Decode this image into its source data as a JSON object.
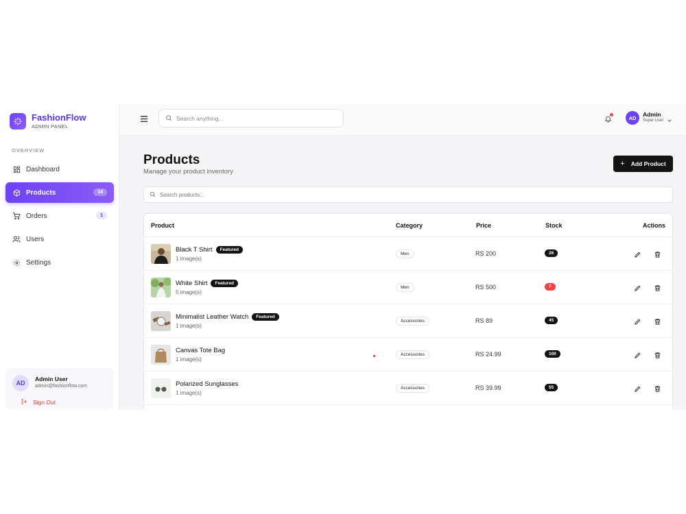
{
  "brand": {
    "name": "FashionFlow",
    "subtitle": "ADMIN PANEL"
  },
  "sidebar": {
    "section_label": "OVERVIEW",
    "items": [
      {
        "label": "Dashboard",
        "icon": "dashboard-icon",
        "badge": ""
      },
      {
        "label": "Products",
        "icon": "box-icon",
        "badge": "14",
        "active": true
      },
      {
        "label": "Orders",
        "icon": "cart-icon",
        "badge": "1"
      },
      {
        "label": "Users",
        "icon": "users-icon",
        "badge": ""
      },
      {
        "label": "Settings",
        "icon": "gear-icon",
        "badge": ""
      }
    ],
    "user": {
      "initials": "AD",
      "name": "Admin User",
      "email": "admin@fashionflow.com"
    },
    "signout_label": "Sign Out"
  },
  "header": {
    "search_placeholder": "Search anything...",
    "user": {
      "initials": "AD",
      "name": "Admin",
      "role": "Super User"
    }
  },
  "main": {
    "title": "Products",
    "subtitle": "Manage your product inventory",
    "add_button_label": "Add Product",
    "search_placeholder": "Search products...",
    "table": {
      "columns": {
        "product": "Product",
        "category": "Category",
        "price": "Price",
        "stock": "Stock",
        "actions": "Actions"
      },
      "rows": [
        {
          "name": "Black T Shirt",
          "featured": "Featured",
          "images": "1 image(s)",
          "category": "Men",
          "price": "RS 200",
          "stock": "26",
          "low": false
        },
        {
          "name": "White Shirt",
          "featured": "Featured",
          "images": "5 image(s)",
          "category": "Men",
          "price": "RS 500",
          "stock": "7",
          "low": true
        },
        {
          "name": "Minimalist Leather Watch",
          "featured": "Featured",
          "images": "1 image(s)",
          "category": "Accessories",
          "price": "RS 89",
          "stock": "45",
          "low": false
        },
        {
          "name": "Canvas Tote Bag",
          "featured": "",
          "images": "1 image(s)",
          "category": "Accessories",
          "price": "RS 24.99",
          "stock": "100",
          "low": false
        },
        {
          "name": "Polarized Sunglasses",
          "featured": "",
          "images": "1 image(s)",
          "category": "Accessories",
          "price": "RS 39.99",
          "stock": "55",
          "low": false
        }
      ]
    }
  },
  "colors": {
    "accent": "#6d42f5",
    "danger": "#ef4444",
    "dark": "#141414"
  }
}
